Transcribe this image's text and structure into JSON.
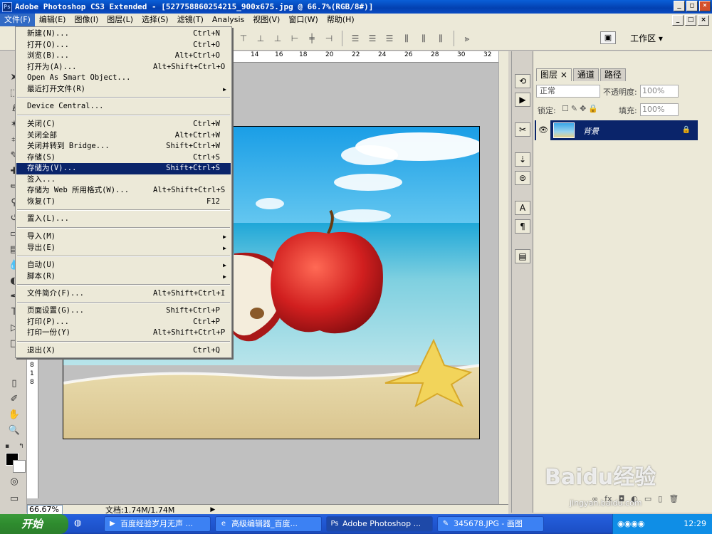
{
  "window": {
    "title": "Adobe Photoshop CS3 Extended - [527758860254215_900x675.jpg @ 66.7%(RGB/8#)]",
    "app_icon": "Ps"
  },
  "menubar": [
    "文件(F)",
    "编辑(E)",
    "图像(I)",
    "图层(L)",
    "选择(S)",
    "滤镜(T)",
    "Analysis",
    "视图(V)",
    "窗口(W)",
    "帮助(H)"
  ],
  "optionsbar": {
    "workspace": "工作区 ▾"
  },
  "file_menu": {
    "items": [
      {
        "label": "新建(N)...",
        "shortcut": "Ctrl+N"
      },
      {
        "label": "打开(O)...",
        "shortcut": "Ctrl+O"
      },
      {
        "label": "浏览(B)...",
        "shortcut": "Alt+Ctrl+O"
      },
      {
        "label": "打开为(A)...",
        "shortcut": "Alt+Shift+Ctrl+O"
      },
      {
        "label": "Open As Smart Object...",
        "shortcut": ""
      },
      {
        "label": "最近打开文件(R)",
        "shortcut": "",
        "submenu": true
      },
      {
        "label": "Device Central...",
        "shortcut": ""
      },
      {
        "label": "关闭(C)",
        "shortcut": "Ctrl+W"
      },
      {
        "label": "关闭全部",
        "shortcut": "Alt+Ctrl+W"
      },
      {
        "label": "关闭并转到 Bridge...",
        "shortcut": "Shift+Ctrl+W"
      },
      {
        "label": "存储(S)",
        "shortcut": "Ctrl+S"
      },
      {
        "label": "存储为(V)...",
        "shortcut": "Shift+Ctrl+S",
        "highlight": true
      },
      {
        "label": "签入...",
        "shortcut": ""
      },
      {
        "label": "存储为 Web 所用格式(W)...",
        "shortcut": "Alt+Shift+Ctrl+S"
      },
      {
        "label": "恢复(T)",
        "shortcut": "F12"
      },
      {
        "label": "置入(L)...",
        "shortcut": ""
      },
      {
        "label": "导入(M)",
        "shortcut": "",
        "submenu": true
      },
      {
        "label": "导出(E)",
        "shortcut": "",
        "submenu": true
      },
      {
        "label": "自动(U)",
        "shortcut": "",
        "submenu": true
      },
      {
        "label": "脚本(R)",
        "shortcut": "",
        "submenu": true
      },
      {
        "label": "文件简介(F)...",
        "shortcut": "Alt+Shift+Ctrl+I"
      },
      {
        "label": "页面设置(G)...",
        "shortcut": "Shift+Ctrl+P"
      },
      {
        "label": "打印(P)...",
        "shortcut": "Ctrl+P"
      },
      {
        "label": "打印一份(Y)",
        "shortcut": "Alt+Shift+Ctrl+P"
      },
      {
        "label": "退出(X)",
        "shortcut": "Ctrl+Q"
      }
    ]
  },
  "ruler": {
    "top_ticks": [
      "14",
      "16",
      "18",
      "20",
      "22",
      "24",
      "26",
      "28",
      "30",
      "32"
    ],
    "left_ticks": [
      "8",
      "1",
      "8"
    ]
  },
  "status": {
    "zoom": "66.67%",
    "doc": "文档:1.74M/1.74M"
  },
  "layers_panel": {
    "tabs": [
      "图层 ×",
      "通道",
      "路径"
    ],
    "blend_mode": "正常",
    "opacity_label": "不透明度:",
    "opacity": "100%",
    "lock_label": "锁定:",
    "fill_label": "填充:",
    "fill": "100%",
    "layer_name": "背景"
  },
  "taskbar": {
    "start": "开始",
    "tasks": [
      {
        "label": "百度经验岁月无声 ..."
      },
      {
        "label": "高级编辑器_百度..."
      },
      {
        "label": "Adobe Photoshop ...",
        "active": true
      },
      {
        "label": "345678.JPG - 画图"
      }
    ],
    "clock": "12:29"
  },
  "watermark": {
    "text": "Baidu经验",
    "url": "jingyan.baidu.com"
  }
}
